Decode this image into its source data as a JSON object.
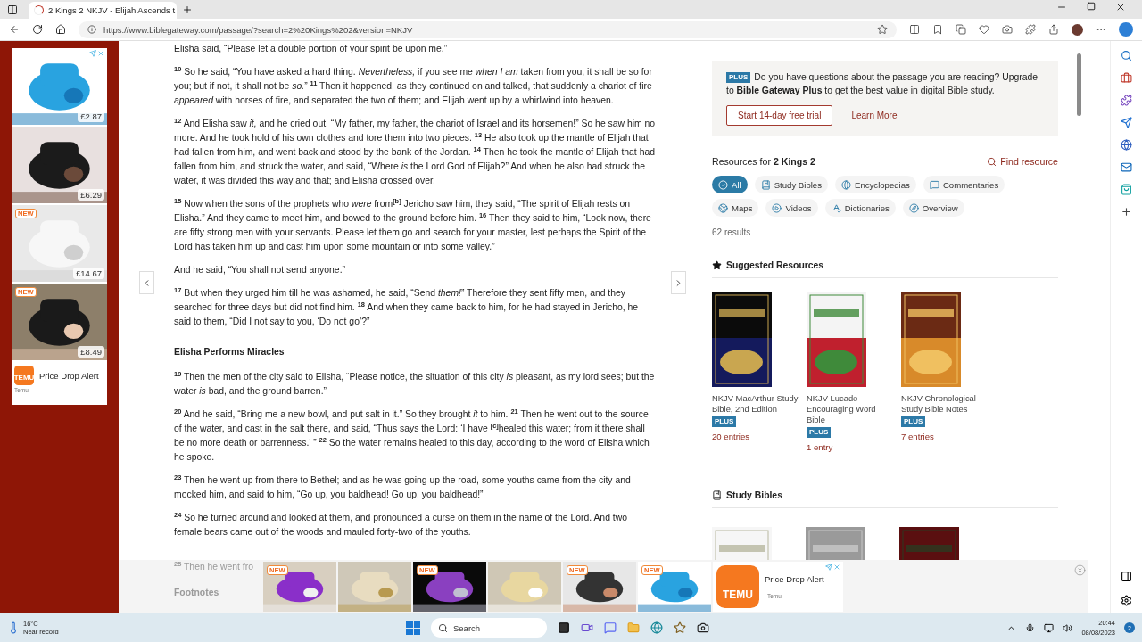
{
  "browser": {
    "tab": {
      "title": "2 Kings 2 NKJV - Elijah Ascends t",
      "selected": true
    },
    "address": "https://www.biblegateway.com/passage/?search=2%20Kings%202&version=NKJV"
  },
  "left_ad": {
    "products": [
      {
        "price": "£2.87"
      },
      {
        "price": "£6.29"
      },
      {
        "price": "£14.67",
        "badge": "NEW"
      },
      {
        "price": "£8.49",
        "badge": "NEW"
      }
    ],
    "brand_logo": "TEMU",
    "title": "Price Drop Alert",
    "advertiser": "Temu"
  },
  "passage": {
    "paragraphs": [
      {
        "kind": "verse",
        "text": "Elisha said, “Please let a double portion of your spirit be upon me.”"
      },
      {
        "kind": "verse",
        "text": "$^{10}$ So he said, “You have asked a hard thing. *Nevertheless,* if you see me *when I am* taken from you, it shall be so for you; but if not, it shall not be *so.*” $^{11}$ Then it happened, as they continued on and talked, that suddenly a chariot of fire *appeared* with horses of fire, and separated the two of them; and Elijah went up by a whirlwind into heaven."
      },
      {
        "kind": "verse",
        "text": "$^{12}$ And Elisha saw *it,* and he cried out, “My father, my father, the chariot of Israel and its horsemen!” So he saw him no more. And he took hold of his own clothes and tore them into two pieces. $^{13}$ He also took up the mantle of Elijah that had fallen from him, and went back and stood by the bank of the Jordan. $^{14}$ Then he took the mantle of Elijah that had fallen from him, and struck the water, and said, “Where *is* the Lord God of Elijah?” And when he also had struck the water, it was divided this way and that; and Elisha crossed over."
      },
      {
        "kind": "verse",
        "text": "$^{15}$ Now when the sons of the prophets who *were* from$^{[b]}$ Jericho saw him, they said, “The spirit of Elijah rests on Elisha.” And they came to meet him, and bowed to the ground before him. $^{16}$ Then they said to him, “Look now, there are fifty strong men with your servants. Please let them go and search for your master, lest perhaps the Spirit of the Lord has taken him up and cast him upon some mountain or into some valley.”"
      },
      {
        "kind": "verse",
        "text": "And he said, “You shall not send anyone.”"
      },
      {
        "kind": "verse",
        "text": "$^{17}$ But when they urged him till he was ashamed, he said, “Send *them!*” Therefore they sent fifty men, and they searched for three days but did not find him. $^{18}$ And when they came back to him, for he had stayed in Jericho, he said to them, “Did I not say to you, ‘Do not go’?”"
      },
      {
        "kind": "heading",
        "text": "Elisha Performs Miracles"
      },
      {
        "kind": "verse",
        "text": "$^{19}$ Then the men of the city said to Elisha, “Please notice, the situation of this city *is* pleasant, as my lord sees; but the water *is* bad, and the ground barren.”"
      },
      {
        "kind": "verse",
        "text": "$^{20}$ And he said, “Bring me a new bowl, and put salt in it.” So they brought *it* to him. $^{21}$ Then he went out to the source of the water, and cast in the salt there, and said, “Thus says the Lord: ‘I have $^{[c]}$healed this water; from it there shall be no more death or barrenness.’ ” $^{22}$ So the water remains healed to this day, according to the word of Elisha which he spoke."
      },
      {
        "kind": "verse",
        "text": "$^{23}$ Then he went up from there to Bethel; and as he was going up the road, some youths came from the city and mocked him, and said to him, “Go up, you baldhead! Go up, you baldhead!”"
      },
      {
        "kind": "verse",
        "text": "$^{24}$ So he turned around and looked at them, and pronounced a curse on them in the name of the Lord. And two female bears came out of the woods and mauled forty-two of the youths."
      }
    ],
    "faded_verse": "$^{25}$ Then he went fro",
    "footnotes_heading": "Footnotes"
  },
  "sidebar": {
    "promo": {
      "badge": "PLUS",
      "text": "Do you have questions about the passage you are reading? Upgrade to **Bible Gateway Plus** to get the best value in digital Bible study.",
      "trial_button": "Start 14-day free trial",
      "learn_more": "Learn More"
    },
    "resources_title": "Resources for **2 Kings 2**",
    "find_resource": "Find resource",
    "filters": [
      {
        "label": "All",
        "selected": true
      },
      {
        "label": "Study Bibles",
        "selected": false
      },
      {
        "label": "Encyclopedias",
        "selected": false
      },
      {
        "label": "Commentaries",
        "selected": false
      },
      {
        "label": "Maps",
        "selected": false
      },
      {
        "label": "Videos",
        "selected": false
      },
      {
        "label": "Dictionaries",
        "selected": false
      },
      {
        "label": "Overview",
        "selected": false
      }
    ],
    "results": "62 results",
    "suggested": {
      "title": "Suggested Resources",
      "books": [
        {
          "title": "NKJV MacArthur Study Bible, 2nd Edition",
          "plus": "PLUS",
          "entries": "20 entries"
        },
        {
          "title": "NKJV Lucado Encouraging Word Bible",
          "plus": "PLUS",
          "entries": "1 entry"
        },
        {
          "title": "NKJV Chronological Study Bible Notes",
          "plus": "PLUS",
          "entries": "7 entries"
        }
      ]
    },
    "study_bibles": {
      "title": "Study Bibles",
      "covers": [
        {
          "kind": "picture"
        },
        {
          "kind": "picture"
        },
        {
          "kind": "picture"
        }
      ]
    }
  },
  "bottom_ad": {
    "products": [
      {
        "kind": "picture",
        "badge": "NEW"
      },
      {
        "kind": "picture"
      },
      {
        "kind": "picture",
        "badge": "NEW"
      },
      {
        "kind": "picture"
      },
      {
        "kind": "picture",
        "badge": "NEW"
      },
      {
        "kind": "picture",
        "badge": "NEW"
      }
    ],
    "brand_logo": "TEMU",
    "title": "Price Drop Alert",
    "advertiser": "Temu"
  },
  "taskbar": {
    "weather": {
      "temp": "16°C",
      "note": "Near record"
    },
    "search": {
      "placeholder": "Search"
    },
    "clock": {
      "time": "20:44",
      "date": "08/08/2023"
    },
    "notifications": "2"
  }
}
